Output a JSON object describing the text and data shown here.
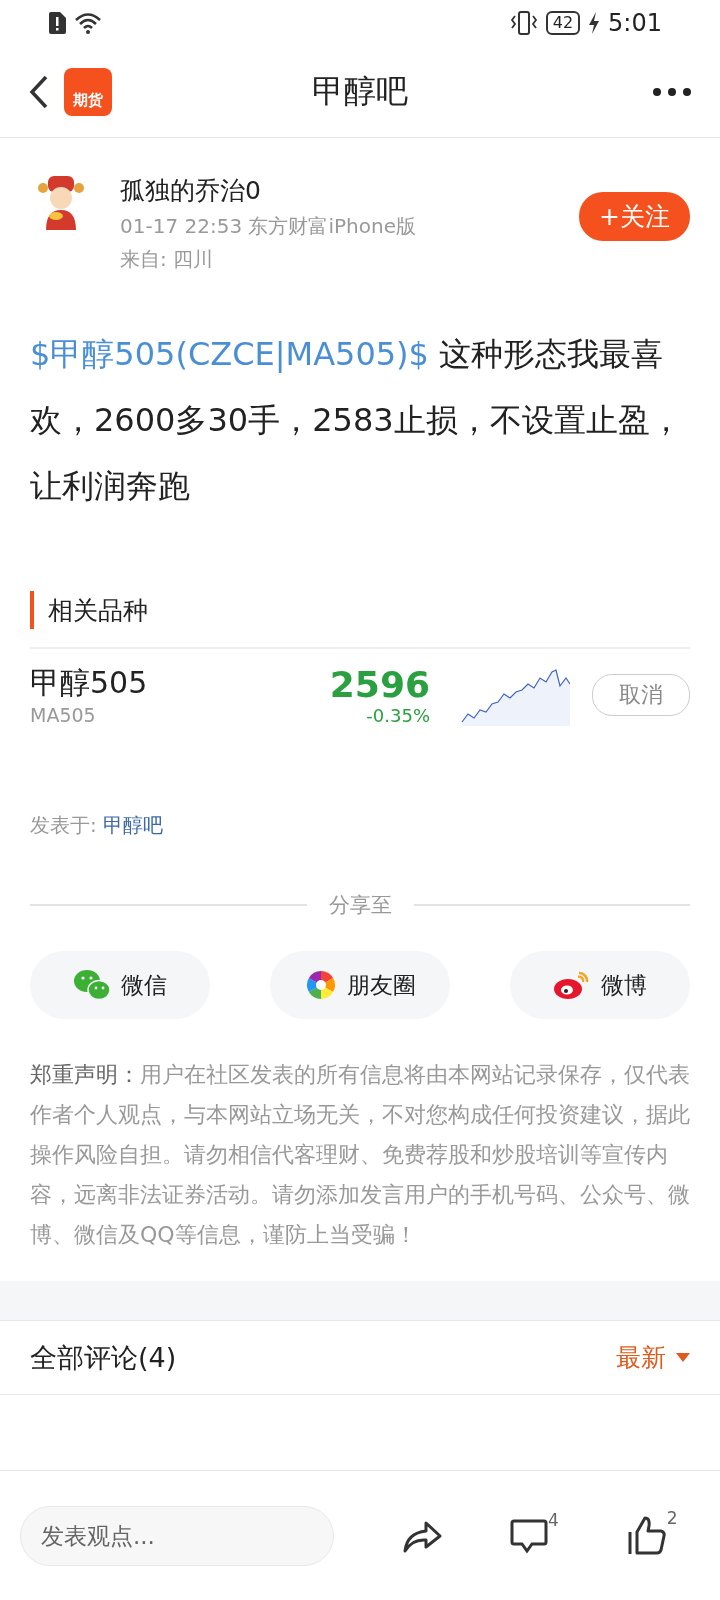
{
  "status_bar": {
    "battery": "42",
    "time": "5:01"
  },
  "header": {
    "app_badge": "期货",
    "title": "甲醇吧"
  },
  "author": {
    "name": "孤独的乔治0",
    "meta": "01-17 22:53 东方财富iPhone版",
    "location": "来自: 四川",
    "follow": "+关注"
  },
  "post": [
    {
      "kind": "link",
      "text": "$甲醇505(CZCE|MA505)$"
    },
    {
      "kind": "plain",
      "text": " 这种形态我最喜欢，2600多30手，2583止损，不设置止盈，让利润奔跑"
    }
  ],
  "related": {
    "title": "相关品种",
    "items": [
      {
        "name": "甲醇505",
        "code": "MA505",
        "price": "2596",
        "change": "-0.35%",
        "action": "取消"
      }
    ]
  },
  "posted_in": {
    "label": "发表于:",
    "bar": "甲醇吧"
  },
  "share": {
    "title": "分享至",
    "targets": [
      {
        "kind": "wechat",
        "label": "微信"
      },
      {
        "kind": "moments",
        "label": "朋友圈"
      },
      {
        "kind": "weibo",
        "label": "微博"
      }
    ]
  },
  "disclaimer": {
    "label": "郑重声明：",
    "text": "用户在社区发表的所有信息将由本网站记录保存，仅代表作者个人观点，与本网站立场无关，不对您构成任何投资建议，据此操作风险自担。请勿相信代客理财、免费荐股和炒股培训等宣传内容，远离非法证券活动。请勿添加发言用户的手机号码、公众号、微博、微信及QQ等信息，谨防上当受骗！"
  },
  "comments": {
    "title": "全部评论(4)",
    "sort": "最新"
  },
  "bottom_bar": {
    "placeholder": "发表观点...",
    "comment_count": "4",
    "like_count": "2"
  }
}
